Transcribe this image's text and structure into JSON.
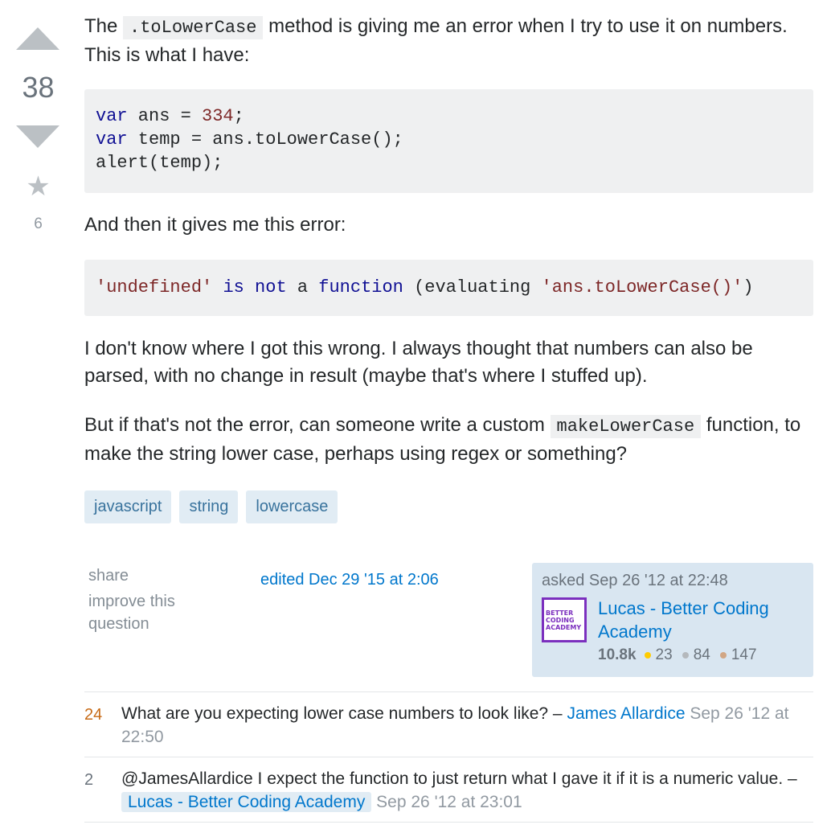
{
  "vote": {
    "count": "38",
    "favorites": "6"
  },
  "question": {
    "p1_before": "The ",
    "p1_code": ".toLowerCase",
    "p1_after": " method is giving me an error when I try to use it on numbers. This is what I have:",
    "code1": {
      "line1": {
        "kw": "var",
        "rest": " ans = ",
        "num": "334",
        "end": ";"
      },
      "line2": {
        "kw": "var",
        "rest": " temp = ans.toLowerCase();"
      },
      "line3": "alert(temp);"
    },
    "p2": "And then it gives me this error:",
    "code2": {
      "s1": "'undefined'",
      "k1": "is",
      "k2": "not",
      "mid": "a",
      "k3": "function",
      "paren": "(evaluating ",
      "s2": "'ans.toLowerCase()'",
      "close": ")"
    },
    "p3": "I don't know where I got this wrong. I always thought that numbers can also be parsed, with no change in result (maybe that's where I stuffed up).",
    "p4_before": "But if that's not the error, can someone write a custom ",
    "p4_code": "makeLowerCase",
    "p4_after": " function, to make the string lower case, perhaps using regex or something?",
    "tags": [
      "javascript",
      "string",
      "lowercase"
    ]
  },
  "menu": {
    "share": "share",
    "improve": "improve this question"
  },
  "edited": "edited Dec 29 '15 at 2:06",
  "owner": {
    "asked": "asked Sep 26 '12 at 22:48",
    "avatar_text": "BETTER CODING ACADEMY",
    "name": "Lucas - Better Coding Academy",
    "reputation": "10.8k",
    "gold": "23",
    "silver": "84",
    "bronze": "147"
  },
  "comments": [
    {
      "score": "24",
      "text": "What are you expecting lower case numbers to look like? – ",
      "user": "James Allardice",
      "date": "Sep 26 '12 at 22:50"
    },
    {
      "score": "2",
      "text": "@JamesAllardice I expect the function to just return what I gave it if it is a numeric value. – ",
      "user": "Lucas - Better Coding Academy",
      "date": "Sep 26 '12 at 23:01"
    }
  ],
  "colors": {
    "link": "#0077cc",
    "tag_bg": "#e1ecf4",
    "owner_bg": "#d9e6f1",
    "hot_score": "#c76a16"
  }
}
